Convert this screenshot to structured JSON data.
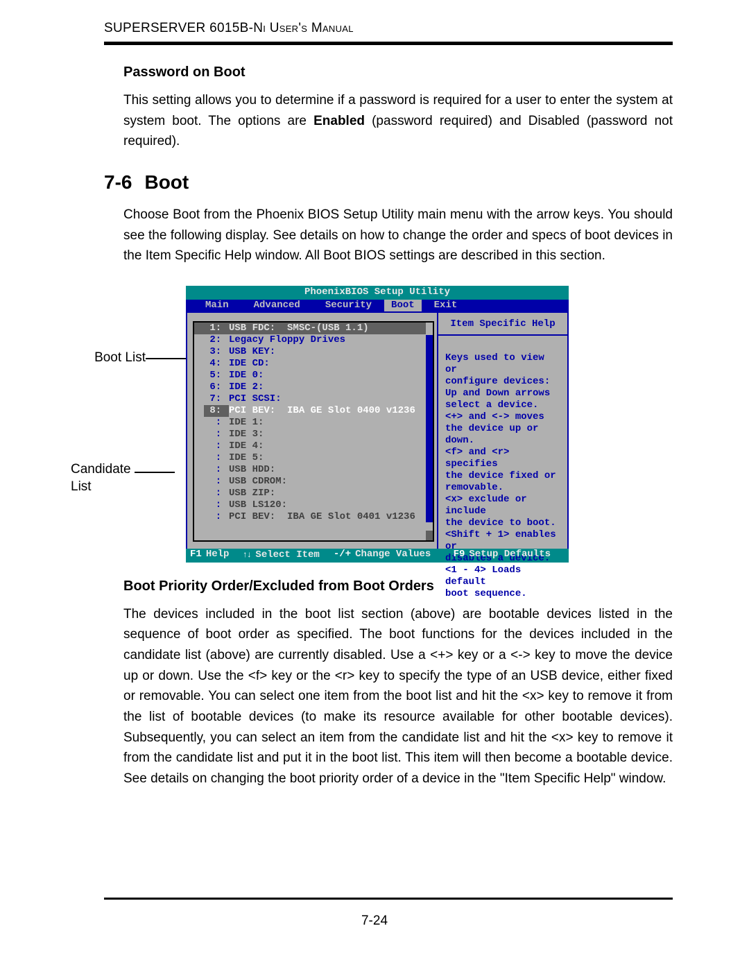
{
  "running_head": "SUPERSERVER 6015B-Ni User's Manual",
  "section1": {
    "heading": "Password on Boot",
    "p1a": "This setting allows you to determine if  a password is required for a user to enter the system at system boot.  The options are ",
    "p1b": "Enabled",
    "p1c": " (password required) and Disabled (password not required)."
  },
  "section2": {
    "num": "7-6",
    "title": "Boot",
    "p1": "Choose Boot from the Phoenix BIOS Setup Utility main menu with the arrow keys.  You should see the following display.  See details on how to change the order and specs of boot devices in the Item Specific Help window.  All Boot BIOS settings are described in this section."
  },
  "callouts": {
    "boot_list": "Boot List",
    "candidate_list": "Candidate\nList"
  },
  "bios": {
    "title": "PhoenixBIOS Setup Utility",
    "menu": [
      "Main",
      "Advanced",
      "Security",
      "Boot",
      "Exit"
    ],
    "menu_active_index": 3,
    "boot_list": [
      {
        "idx": "1:",
        "label": "USB FDC:  SMSC-(USB 1.1)",
        "style": "hi1"
      },
      {
        "idx": "2:",
        "label": "Legacy Floppy Drives",
        "style": ""
      },
      {
        "idx": "3:",
        "label": "USB KEY:",
        "style": ""
      },
      {
        "idx": "4:",
        "label": "IDE CD:",
        "style": ""
      },
      {
        "idx": "5:",
        "label": "IDE 0:",
        "style": ""
      },
      {
        "idx": "6:",
        "label": "IDE 2:",
        "style": ""
      },
      {
        "idx": "7:",
        "label": "PCI SCSI:",
        "style": ""
      },
      {
        "idx": "8:",
        "label": "PCI BEV:  IBA GE Slot 0400 v1236",
        "style": "hi2"
      }
    ],
    "candidate_list": [
      {
        "idx": ":",
        "label": "IDE 1:",
        "style": "dim"
      },
      {
        "idx": ":",
        "label": "IDE 3:",
        "style": "dim"
      },
      {
        "idx": ":",
        "label": "IDE 4:",
        "style": "dim"
      },
      {
        "idx": ":",
        "label": "IDE 5:",
        "style": "dim"
      },
      {
        "idx": ":",
        "label": "USB HDD:",
        "style": "dim"
      },
      {
        "idx": ":",
        "label": "USB CDROM:",
        "style": "dim"
      },
      {
        "idx": ":",
        "label": "USB ZIP:",
        "style": "dim"
      },
      {
        "idx": ":",
        "label": "USB LS120:",
        "style": "dim"
      },
      {
        "idx": ":",
        "label": "PCI BEV:  IBA GE Slot 0401 v1236",
        "style": "dim"
      }
    ],
    "help_title": "Item Specific Help",
    "help_body": "Keys used to view or\nconfigure devices:\nUp and Down arrows\nselect a device.\n<+> and <-> moves\nthe device up or down.\n<f> and <r> specifies\nthe device fixed or\nremovable.\n<x> exclude or include\nthe device to boot.\n<Shift + 1> enables or\ndisables a device.\n<1 - 4> Loads default\nboot sequence.",
    "footer": {
      "f1": "F1",
      "f1_label": "Help",
      "sel_arrows": "↑↓",
      "sel_label": "Select Item",
      "chg_keys": "-/+",
      "chg_label": "Change Values",
      "f9": "F9",
      "f9_label": "Setup Defaults"
    }
  },
  "section3": {
    "heading": "Boot Priority Order/Excluded from Boot Orders",
    "p1": "The devices included in the boot list section (above) are bootable devices listed in the sequence of boot order as specified. The boot functions for the devices included in the candidate list (above) are currently disabled.  Use a <+> key or a <-> key to move the device up or down. Use the <f> key or the <r> key to specify the type of an USB device, either fixed or removable. You can select one item from the boot list and hit the <x> key to remove it from the list of bootable devices (to make its resource available for other bootable devices). Subsequently, you can select an item from the candidate list and hit the <x> key  to remove it from the candidate list and put it in the boot list. This item will then become a bootable device. See details on changing the boot priority order of a device in the \"Item Specific Help\" window."
  },
  "page_number": "7-24"
}
